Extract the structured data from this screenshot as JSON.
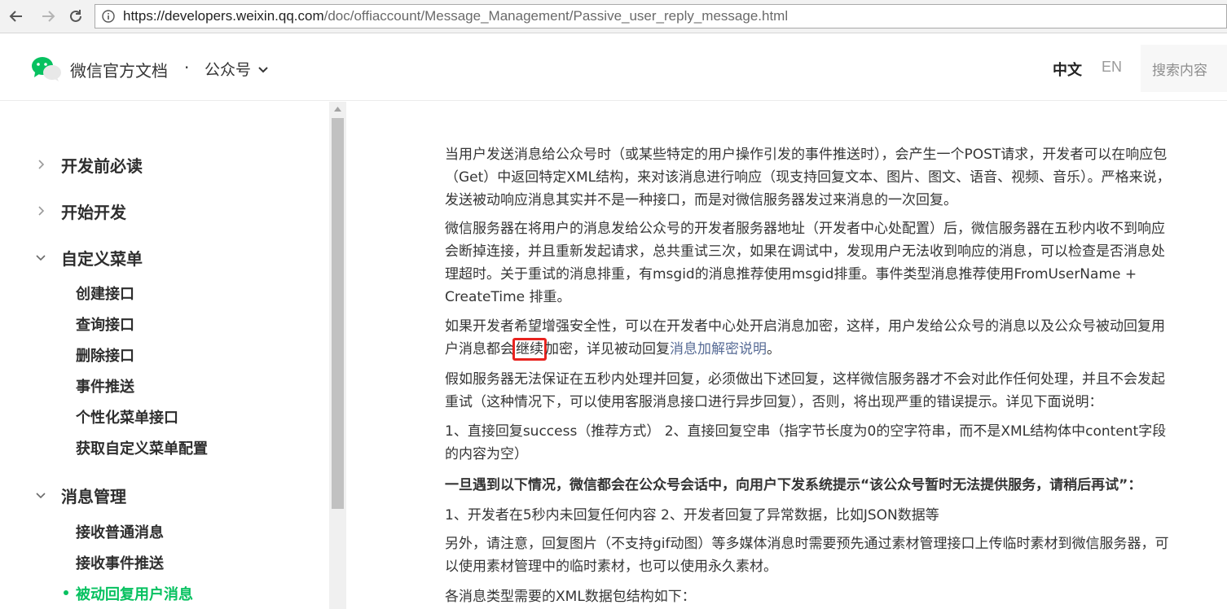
{
  "browser": {
    "url_host": "https://developers.weixin.qq.com",
    "url_path": "/doc/offiaccount/Message_Management/Passive_user_reply_message.html",
    "icons": [
      "back-icon",
      "forward-icon",
      "reload-icon",
      "info-icon"
    ]
  },
  "header": {
    "site_title": "微信官方文档",
    "separator": "·",
    "product": "公众号",
    "lang_zh": "中文",
    "lang_en": "EN",
    "search_placeholder": "搜索内容",
    "brand_color": "#07c160"
  },
  "sidebar": {
    "groups": [
      {
        "label": "开发前必读",
        "expanded": false
      },
      {
        "label": "开始开发",
        "expanded": false
      },
      {
        "label": "自定义菜单",
        "expanded": true,
        "items": [
          "创建接口",
          "查询接口",
          "删除接口",
          "事件推送",
          "个性化菜单接口",
          "获取自定义菜单配置"
        ]
      },
      {
        "label": "消息管理",
        "expanded": true,
        "items": [
          "接收普通消息",
          "接收事件推送",
          "被动回复用户消息"
        ]
      }
    ],
    "active_item": "被动回复用户消息"
  },
  "content": {
    "p1": "当用户发送消息给公众号时（或某些特定的用户操作引发的事件推送时），会产生一个POST请求，开发者可以在响应包（Get）中返回特定XML结构，来对该消息进行响应（现支持回复文本、图片、图文、语音、视频、音乐）。严格来说，发送被动响应消息其实并不是一种接口，而是对微信服务器发过来消息的一次回复。",
    "p2": "微信服务器在将用户的消息发给公众号的开发者服务器地址（开发者中心处配置）后，微信服务器在五秒内收不到响应会断掉连接，并且重新发起请求，总共重试三次，如果在调试中，发现用户无法收到响应的消息，可以检查是否消息处理超时。关于重试的消息排重，有msgid的消息推荐使用msgid排重。事件类型消息推荐使用FromUserName + CreateTime 排重。",
    "p3_before": "如果开发者希望增强安全性，可以在开发者中心处开启消息加密，这样，用户发给公众号的消息以及公众号被动回复用户消息都会",
    "p3_highlight": "继续",
    "p3_after": "加密，详见被动回复",
    "p3_link": "消息加解密说明",
    "p3_end": "。",
    "p4": "假如服务器无法保证在五秒内处理并回复，必须做出下述回复，这样微信服务器才不会对此作任何处理，并且不会发起重试（这种情况下，可以使用客服消息接口进行异步回复），否则，将出现严重的错误提示。详见下面说明：",
    "p5": "1、直接回复success（推荐方式） 2、直接回复空串（指字节长度为0的空字符串，而不是XML结构体中content字段的内容为空）",
    "p6": "一旦遇到以下情况，微信都会在公众号会话中，向用户下发系统提示“该公众号暂时无法提供服务，请稍后再试”：",
    "p7": "1、开发者在5秒内未回复任何内容 2、开发者回复了异常数据，比如JSON数据等",
    "p8": "另外，请注意，回复图片（不支持gif动图）等多媒体消息时需要预先通过素材管理接口上传临时素材到微信服务器，可以使用素材管理中的临时素材，也可以使用永久素材。",
    "p9": "各消息类型需要的XML数据包结构如下：",
    "highlight_color": "#e8231f",
    "link_color": "#576b95"
  }
}
